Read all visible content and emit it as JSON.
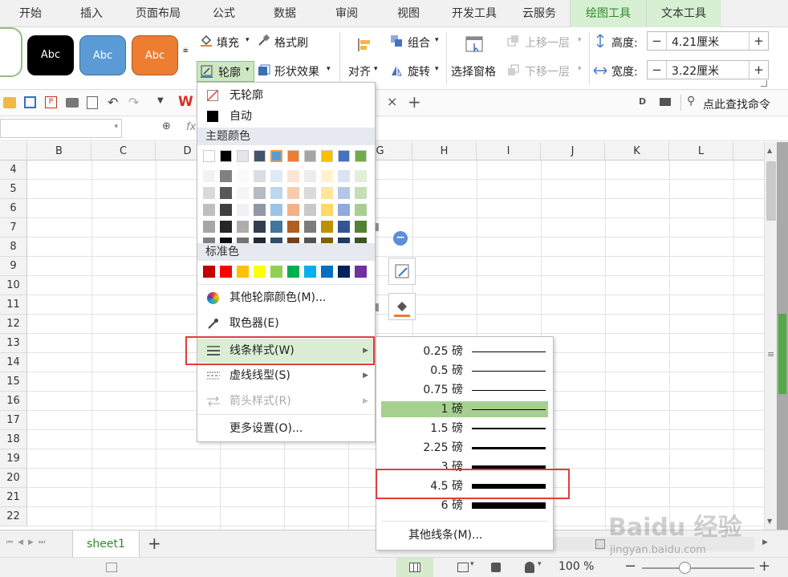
{
  "menu_tabs": [
    "开始",
    "插入",
    "页面布局",
    "公式",
    "数据",
    "审阅",
    "视图",
    "开发工具",
    "云服务",
    "绘图工具",
    "文本工具"
  ],
  "ribbon": {
    "shape_style_text": "Abc",
    "fill": "填充",
    "format_brush": "格式刷",
    "outline": "轮廓",
    "shape_effect": "形状效果",
    "align": "对齐",
    "group": "组合",
    "rotate": "旋转",
    "select_pane": "选择窗格",
    "bring_forward": "上移一层",
    "send_backward": "下移一层",
    "height_label": "高度:",
    "height_value": "4.21厘米",
    "width_label": "宽度:",
    "width_value": "3.22厘米"
  },
  "quickbar": {
    "search": "点此查找命令"
  },
  "columns": [
    "B",
    "C",
    "D",
    "G",
    "H",
    "I",
    "J",
    "K",
    "L"
  ],
  "rows": [
    "4",
    "5",
    "6",
    "7",
    "8",
    "9",
    "10",
    "11",
    "12",
    "13",
    "14",
    "15",
    "16",
    "17",
    "18",
    "19",
    "20",
    "21",
    "22"
  ],
  "sheet_tab": "sheet1",
  "zoom": "100 %",
  "outline_menu": {
    "no_outline": "无轮廓",
    "auto": "自动",
    "theme_colors": "主题颜色",
    "standard_colors": "标准色",
    "more_colors": "其他轮廓颜色(M)...",
    "eyedropper": "取色器(E)",
    "line_style": "线条样式(W)",
    "dash_type": "虚线线型(S)",
    "arrow_style": "箭头样式(R)",
    "more_settings": "更多设置(O)..."
  },
  "line_weights": [
    {
      "label": "0.25 磅",
      "weight": 0.25
    },
    {
      "label": "0.5 磅",
      "weight": 0.5
    },
    {
      "label": "0.75 磅",
      "weight": 0.75
    },
    {
      "label": "1 磅",
      "weight": 1
    },
    {
      "label": "1.5 磅",
      "weight": 1.5
    },
    {
      "label": "2.25 磅",
      "weight": 2.25
    },
    {
      "label": "3 磅",
      "weight": 3
    },
    {
      "label": "4.5 磅",
      "weight": 4.5
    },
    {
      "label": "6 磅",
      "weight": 6
    }
  ],
  "more_lines": "其他线条(M)...",
  "selected_weight": "1 磅",
  "highlighted_weight": "4.5 磅",
  "colors": {
    "accent_green": "#2c8a2c",
    "menu_highlight": "#dbeed5",
    "weight_highlight": "#a6d08f",
    "annotation_red": "#e03d3d",
    "theme_row": [
      "#ffffff",
      "#000000",
      "#e7e6e6",
      "#44546a",
      "#5b9bd5",
      "#ed7d31",
      "#a5a5a5",
      "#ffc000",
      "#4472c4",
      "#70ad47"
    ],
    "standard_row": [
      "#c00000",
      "#ff0000",
      "#ffc000",
      "#ffff00",
      "#92d050",
      "#00b050",
      "#00b0f0",
      "#0070c0",
      "#002060",
      "#7030a0"
    ]
  },
  "watermark": {
    "logo": "Baidu 经验",
    "url": "jingyan.baidu.com"
  }
}
